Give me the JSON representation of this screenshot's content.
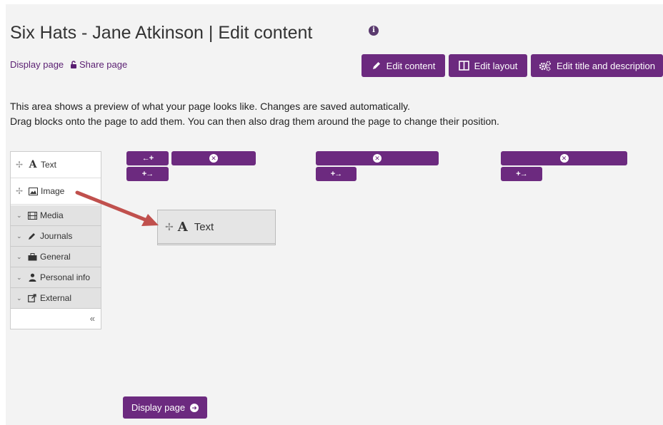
{
  "page": {
    "title": "Six Hats - Jane Atkinson | Edit content",
    "links": {
      "display_page": "Display page",
      "share_page": "Share page"
    }
  },
  "toolbar": {
    "edit_content": "Edit content",
    "edit_layout": "Edit layout",
    "edit_title_description": "Edit title and description"
  },
  "description": {
    "line1": "This area shows a preview of what your page looks like. Changes are saved automatically.",
    "line2": "Drag blocks onto the page to add them. You can then also drag them around the page to change their position."
  },
  "sidebar": {
    "blocks": [
      {
        "label": "Text",
        "icon": "text-a-icon"
      },
      {
        "label": "Image",
        "icon": "image-icon"
      }
    ],
    "categories": [
      {
        "label": "Media",
        "icon": "film-icon"
      },
      {
        "label": "Journals",
        "icon": "pencil-icon"
      },
      {
        "label": "General",
        "icon": "briefcase-icon"
      },
      {
        "label": "Personal info",
        "icon": "user-icon"
      },
      {
        "label": "External",
        "icon": "external-link-icon"
      }
    ],
    "collapse_glyph": "«"
  },
  "dragged_block": {
    "label": "Text",
    "icon": "text-a-icon"
  },
  "footer": {
    "display_page_button": "Display page"
  },
  "colors": {
    "accent": "#6c2a7f",
    "link": "#5a1f72",
    "arrow": "#c0504d",
    "background": "#f3f3f3"
  }
}
